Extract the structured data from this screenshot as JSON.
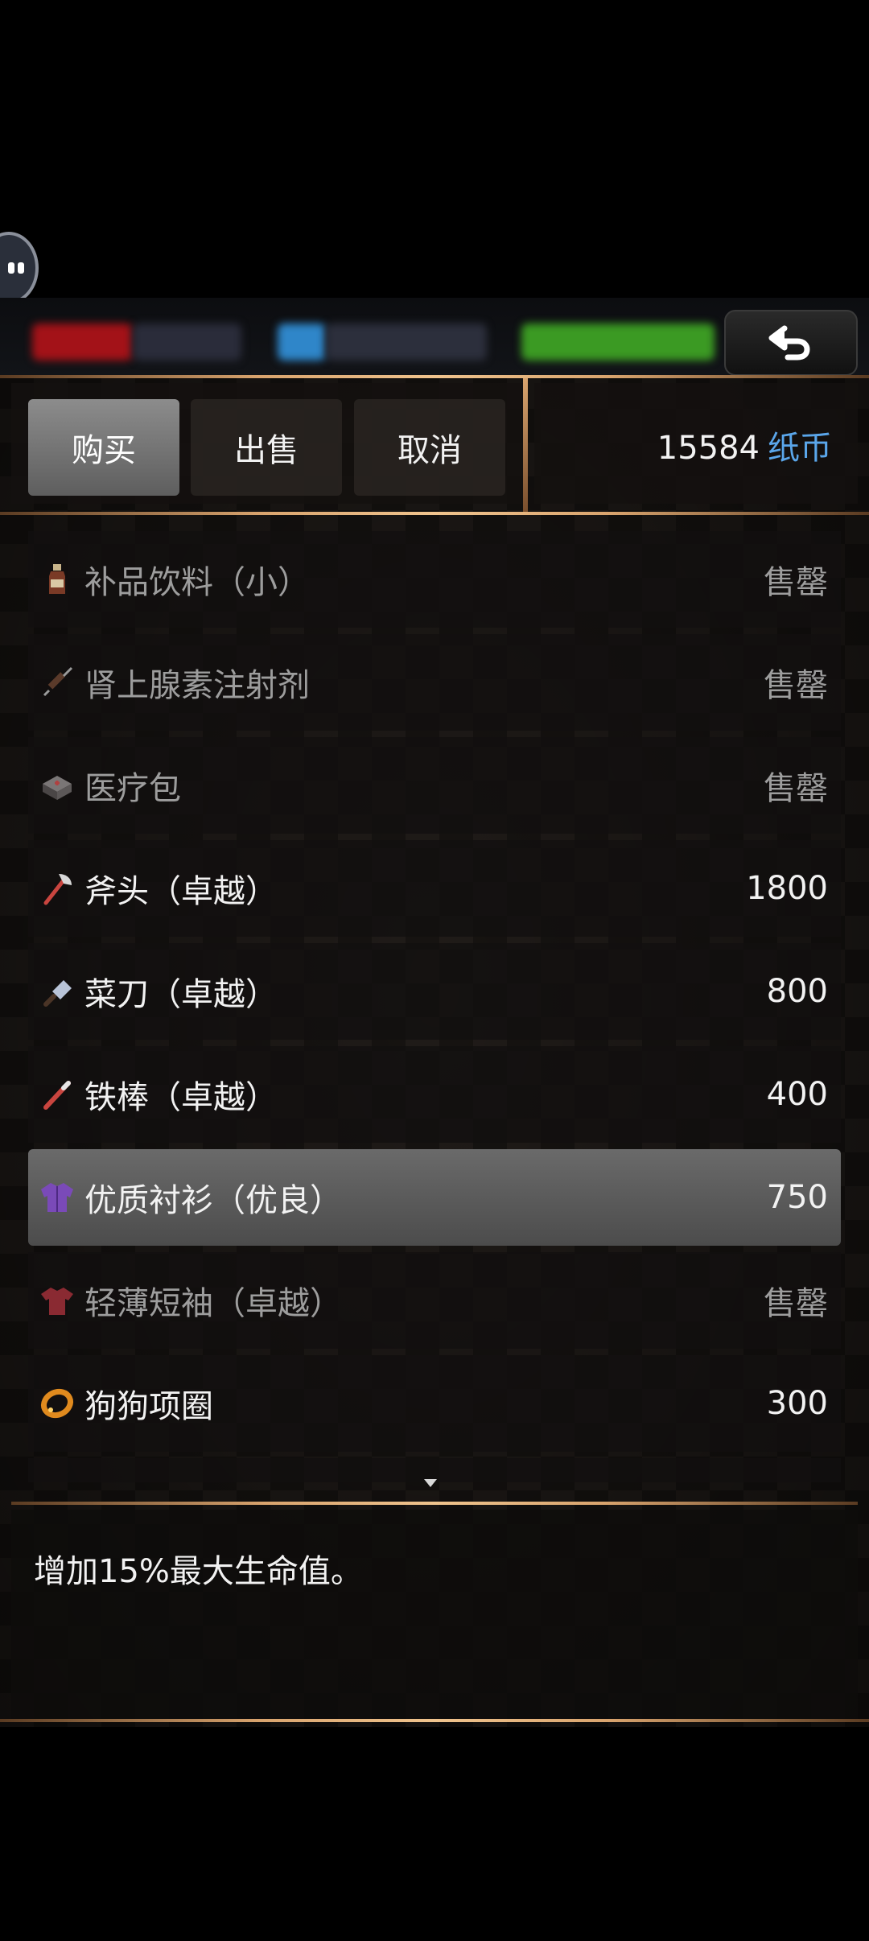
{
  "tabs": {
    "buy": "购买",
    "sell": "出售",
    "cancel": "取消"
  },
  "currency": {
    "amount": "15584",
    "unit": "纸币"
  },
  "items": [
    {
      "name": "补品饮料（小）",
      "price": "售罄",
      "icon": "drink-bottle-icon"
    },
    {
      "name": "肾上腺素注射剂",
      "price": "售罄",
      "icon": "syringe-icon"
    },
    {
      "name": "医疗包",
      "price": "售罄",
      "icon": "medkit-icon"
    },
    {
      "name": "斧头（卓越）",
      "price": "1800",
      "icon": "axe-icon"
    },
    {
      "name": "菜刀（卓越）",
      "price": "800",
      "icon": "cleaver-icon"
    },
    {
      "name": "铁棒（卓越）",
      "price": "400",
      "icon": "iron-rod-icon"
    },
    {
      "name": "优质衬衫（优良）",
      "price": "750",
      "icon": "shirt-icon"
    },
    {
      "name": "轻薄短袖（卓越）",
      "price": "售罄",
      "icon": "tshirt-icon"
    },
    {
      "name": "狗狗项圈",
      "price": "300",
      "icon": "dog-collar-icon"
    }
  ],
  "selected_index": 6,
  "description": "增加15%最大生命值。",
  "colors": {
    "currency_unit": "#5aa6ea",
    "frame_gold": "#d9a46e",
    "selected_row": "#5e5e5e",
    "hp_bar": "#a31218",
    "mp_bar": "#2f86c9",
    "stamina_bar": "#3b9a23"
  }
}
